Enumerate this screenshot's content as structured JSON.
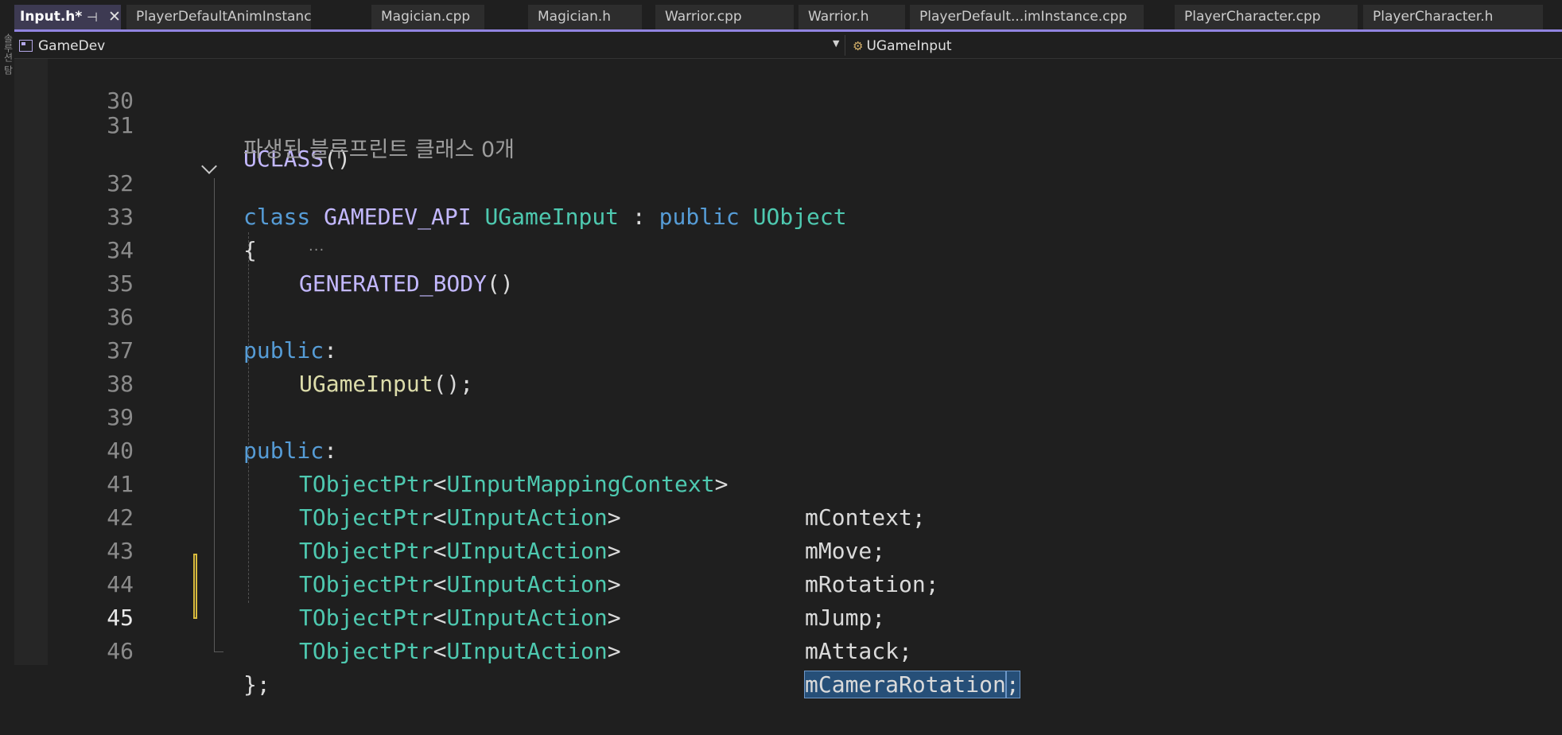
{
  "left_strip": {
    "label": "솔루션 탐"
  },
  "tabs": [
    {
      "label": "Input.h*",
      "active": true
    },
    {
      "label": "PlayerDefaultAnimInstance.h"
    },
    {
      "label": "Magician.cpp"
    },
    {
      "label": "Magician.h"
    },
    {
      "label": "Warrior.cpp"
    },
    {
      "label": "Warrior.h"
    },
    {
      "label": "PlayerDefault...imInstance.cpp"
    },
    {
      "label": "PlayerCharacter.cpp"
    },
    {
      "label": "PlayerCharacter.h"
    }
  ],
  "tab_icons": {
    "pin": "pin-icon",
    "close": "close-icon"
  },
  "navbar": {
    "project": "GameDev",
    "member": "UGameInput",
    "project_icon": "project-icon",
    "member_icon": "class-icon",
    "dropdown_icon": "chevron-down-icon"
  },
  "editor": {
    "codelens": "파생된 블루프린트 클래스 0개",
    "line_numbers": [
      "30",
      "31",
      "32",
      "33",
      "34",
      "35",
      "36",
      "37",
      "38",
      "39",
      "40",
      "41",
      "42",
      "43",
      "44",
      "45",
      "46"
    ],
    "current_line": "45",
    "lines": {
      "l31": {
        "macro": "UCLASS",
        "punct": "()"
      },
      "l32": {
        "kw_class": "class",
        "api": "GAMEDEV_API",
        "name": "UGameInput",
        "colon": " : ",
        "kw_public": "public",
        "base": "UObject"
      },
      "l33": {
        "brace": "{"
      },
      "l34": {
        "macro": "GENERATED_BODY",
        "punct": "()"
      },
      "l36": {
        "kw": "public",
        "colon": ":"
      },
      "l37": {
        "ctor": "UGameInput",
        "punct": "();"
      },
      "l39": {
        "kw": "public",
        "colon": ":"
      },
      "members": [
        {
          "ptr": "TObjectPtr",
          "lt": "<",
          "type": "UInputMappingContext",
          "gt": ">",
          "name": "mContext",
          "semi": ";"
        },
        {
          "ptr": "TObjectPtr",
          "lt": "<",
          "type": "UInputAction",
          "gt": ">",
          "name": "mMove",
          "semi": ";"
        },
        {
          "ptr": "TObjectPtr",
          "lt": "<",
          "type": "UInputAction",
          "gt": ">",
          "name": "mRotation",
          "semi": ";"
        },
        {
          "ptr": "TObjectPtr",
          "lt": "<",
          "type": "UInputAction",
          "gt": ">",
          "name": "mJump",
          "semi": ";"
        },
        {
          "ptr": "TObjectPtr",
          "lt": "<",
          "type": "UInputAction",
          "gt": ">",
          "name": "mAttack",
          "semi": ";"
        },
        {
          "ptr": "TObjectPtr",
          "lt": "<",
          "type": "UInputAction",
          "gt": ">",
          "name": "mCameraRotation",
          "semi": ";"
        }
      ],
      "l46": {
        "close": "};"
      }
    },
    "fold_icon": "chevron-down-icon",
    "colors": {
      "keyword": "#569cd6",
      "type": "#4ec9b0",
      "macro": "#c3b8ff",
      "function": "#dcdcaa",
      "selection": "#264f78",
      "change_marker": "#d7ba3d",
      "tab_accent": "#9184e0"
    }
  }
}
